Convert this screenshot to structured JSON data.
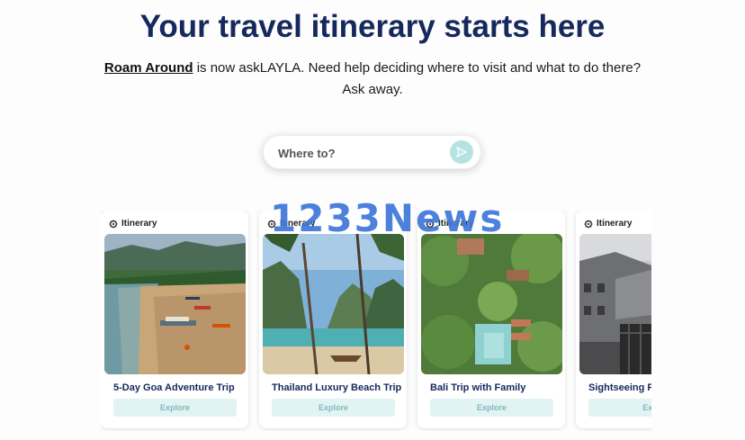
{
  "header": {
    "title": "Your travel itinerary starts here",
    "brand_link": "Roam Around",
    "subtitle_rest": " is now askLAYLA. Need help deciding where to visit and what to do there? Ask away."
  },
  "search": {
    "placeholder": "Where to?",
    "send_icon": "send-icon"
  },
  "watermark": "1233News",
  "cards": [
    {
      "badge": "Itinerary",
      "badge_icon": "gear-icon",
      "title": "5-Day Goa Adventure Trip",
      "button": "Explore",
      "image": "goa-beach-image"
    },
    {
      "badge": "Itinerary",
      "badge_icon": "gear-icon",
      "title": "Thailand Luxury Beach Trip",
      "button": "Explore",
      "image": "thailand-beach-image"
    },
    {
      "badge": "Itinerary",
      "badge_icon": "gear-icon",
      "title": "Bali Trip with Family",
      "button": "Explore",
      "image": "bali-resort-image"
    },
    {
      "badge": "Itinerary",
      "badge_icon": "gear-icon",
      "title": "Sightseeing P",
      "button": "Exp",
      "image": "city-rooftops-image"
    }
  ],
  "colors": {
    "title": "#16295c",
    "accent": "#b6e2e3",
    "button_bg": "#e2f3f3",
    "button_text": "#7fb9bb",
    "watermark": "#3e77d9"
  }
}
